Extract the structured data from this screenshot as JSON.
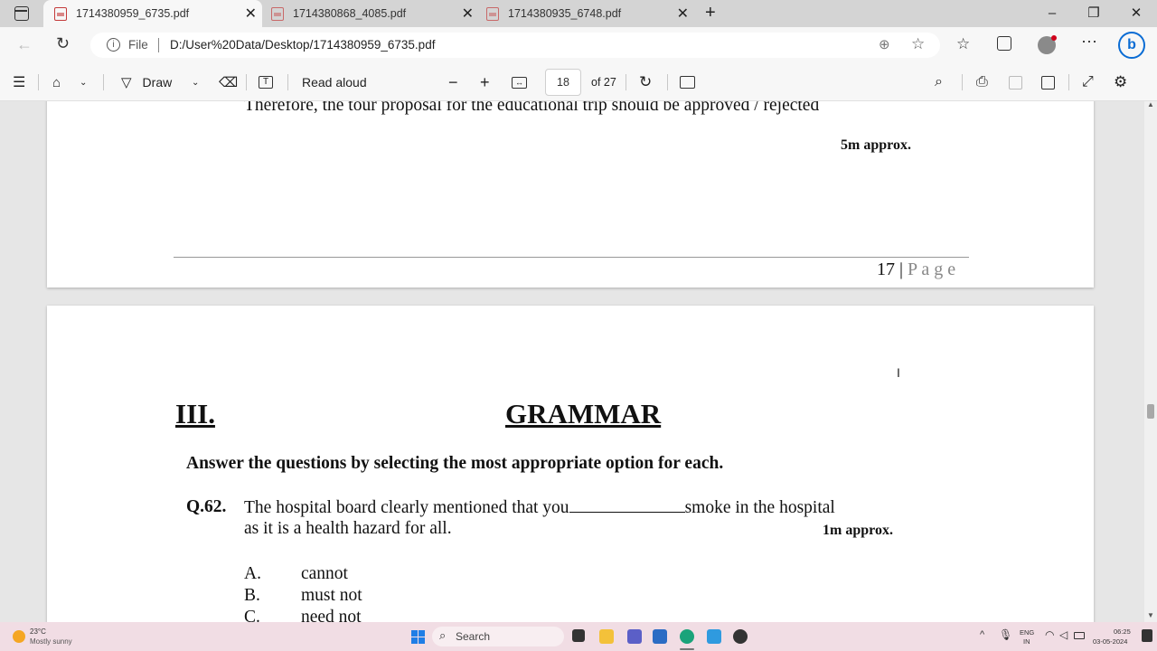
{
  "tabs": [
    {
      "title": "1714380959_6735.pdf",
      "active": true
    },
    {
      "title": "1714380868_4085.pdf",
      "active": false
    },
    {
      "title": "1714380935_6748.pdf",
      "active": false
    }
  ],
  "address": {
    "file_label": "File",
    "url": "D:/User%20Data/Desktop/1714380959_6735.pdf"
  },
  "pdf_toolbar": {
    "draw_label": "Draw",
    "read_aloud_label": "Read aloud",
    "current_page": "18",
    "page_total": "of 27"
  },
  "page17": {
    "body_line": "Therefore, the tour proposal for the educational trip should be approved / rejected",
    "marks": "5m approx.",
    "footer_num": "17 |",
    "footer_page": "P a g e"
  },
  "page18": {
    "section_num": "III.",
    "section_title": "GRAMMAR",
    "instruction": "Answer the questions by selecting the most appropriate option for each.",
    "question": {
      "number": "Q.62.",
      "line1_pre": "The hospital board clearly mentioned that you",
      "line1_post": "smoke in the hospital",
      "line2": "as it is a health hazard for all.",
      "marks": "1m approx."
    },
    "options": [
      {
        "letter": "A.",
        "text": "cannot"
      },
      {
        "letter": "B.",
        "text": "must not"
      },
      {
        "letter": "C.",
        "text": "need not"
      }
    ]
  },
  "taskbar": {
    "weather_temp": "23°C",
    "weather_desc": "Mostly sunny",
    "search_label": "Search",
    "lang_1": "ENG",
    "lang_2": "IN",
    "time": "06:25",
    "date": "03-05-2024"
  },
  "colors": {
    "accent": "#0a6cd4",
    "pdf_red": "#c43b3b",
    "taskbar_bg": "#f1dde4"
  }
}
